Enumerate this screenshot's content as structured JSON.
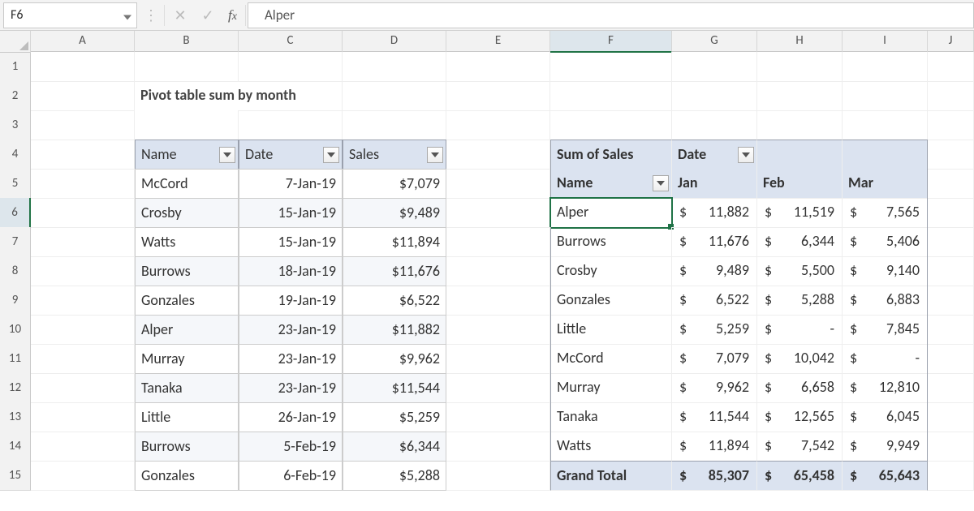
{
  "name_box": "F6",
  "formula_value": "Alper",
  "columns": [
    "A",
    "B",
    "C",
    "D",
    "E",
    "F",
    "G",
    "H",
    "I",
    "J"
  ],
  "active_col_index": 5,
  "row_numbers": [
    "1",
    "2",
    "3",
    "4",
    "5",
    "6",
    "7",
    "8",
    "9",
    "10",
    "11",
    "12",
    "13",
    "14",
    "15"
  ],
  "active_row_index": 5,
  "title": "Pivot table sum by month",
  "data_table": {
    "headers": [
      "Name",
      "Date",
      "Sales"
    ],
    "rows": [
      {
        "name": "McCord",
        "date": "7-Jan-19",
        "sales": "$7,079"
      },
      {
        "name": "Crosby",
        "date": "15-Jan-19",
        "sales": "$9,489"
      },
      {
        "name": "Watts",
        "date": "15-Jan-19",
        "sales": "$11,894"
      },
      {
        "name": "Burrows",
        "date": "18-Jan-19",
        "sales": "$11,676"
      },
      {
        "name": "Gonzales",
        "date": "19-Jan-19",
        "sales": "$6,522"
      },
      {
        "name": "Alper",
        "date": "23-Jan-19",
        "sales": "$11,882"
      },
      {
        "name": "Murray",
        "date": "23-Jan-19",
        "sales": "$9,962"
      },
      {
        "name": "Tanaka",
        "date": "23-Jan-19",
        "sales": "$11,544"
      },
      {
        "name": "Little",
        "date": "26-Jan-19",
        "sales": "$5,259"
      },
      {
        "name": "Burrows",
        "date": "5-Feb-19",
        "sales": "$6,344"
      },
      {
        "name": "Gonzales",
        "date": "6-Feb-19",
        "sales": "$5,288"
      }
    ]
  },
  "pivot": {
    "measure_label": "Sum of Sales",
    "col_field": "Date",
    "row_field": "Name",
    "months": [
      "Jan",
      "Feb",
      "Mar"
    ],
    "rows": [
      {
        "name": "Alper",
        "vals": [
          "$ 11,882",
          "$ 11,519",
          "$  7,565"
        ]
      },
      {
        "name": "Burrows",
        "vals": [
          "$ 11,676",
          "$  6,344",
          "$  5,406"
        ]
      },
      {
        "name": "Crosby",
        "vals": [
          "$  9,489",
          "$  5,500",
          "$  9,140"
        ]
      },
      {
        "name": "Gonzales",
        "vals": [
          "$  6,522",
          "$  5,288",
          "$  6,883"
        ]
      },
      {
        "name": "Little",
        "vals": [
          "$  5,259",
          "$        -",
          "$  7,845"
        ]
      },
      {
        "name": "McCord",
        "vals": [
          "$  7,079",
          "$ 10,042",
          "$        -"
        ]
      },
      {
        "name": "Murray",
        "vals": [
          "$  9,962",
          "$  6,658",
          "$ 12,810"
        ]
      },
      {
        "name": "Tanaka",
        "vals": [
          "$ 11,544",
          "$ 12,565",
          "$  6,045"
        ]
      },
      {
        "name": "Watts",
        "vals": [
          "$ 11,894",
          "$  7,542",
          "$  9,949"
        ]
      }
    ],
    "grand_label": "Grand Total",
    "grand": [
      "$ 85,307",
      "$ 65,458",
      "$ 65,643"
    ]
  },
  "chart_data": {
    "type": "table",
    "title": "Pivot table sum by month — Sum of Sales by Name × Month",
    "columns": [
      "Jan",
      "Feb",
      "Mar"
    ],
    "rows": [
      "Alper",
      "Burrows",
      "Crosby",
      "Gonzales",
      "Little",
      "McCord",
      "Murray",
      "Tanaka",
      "Watts"
    ],
    "values": [
      [
        11882,
        11519,
        7565
      ],
      [
        11676,
        6344,
        5406
      ],
      [
        9489,
        5500,
        9140
      ],
      [
        6522,
        5288,
        6883
      ],
      [
        5259,
        null,
        7845
      ],
      [
        7079,
        10042,
        null
      ],
      [
        9962,
        6658,
        12810
      ],
      [
        11544,
        12565,
        6045
      ],
      [
        11894,
        7542,
        9949
      ]
    ],
    "grand_total": [
      85307,
      65458,
      65643
    ]
  }
}
